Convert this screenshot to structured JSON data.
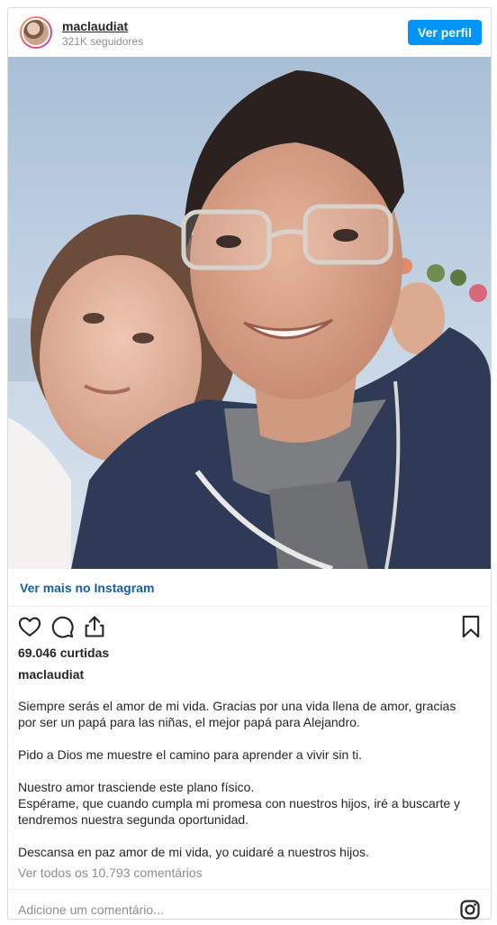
{
  "header": {
    "username": "maclaudiat",
    "followers": "321K seguidores",
    "profile_button": "Ver perfil"
  },
  "post": {
    "see_more": "Ver mais no Instagram",
    "likes": "69.046 curtidas",
    "caption_user": "maclaudiat",
    "caption_paragraphs": [
      "Siempre serás el amor de mi vida. Gracias por una vida llena de amor, gracias por ser un papá para las niñas, el mejor papá para Alejandro.",
      "Pido a Dios me muestre el camino para aprender a vivir sin ti.",
      "Nuestro amor trasciende este plano físico.",
      "Espérame, que cuando cumpla mi promesa con nuestros hijos, iré a buscarte y tendremos nuestra segunda oportunidad.",
      "Descansa en paz amor de mi vida, yo cuidaré a nuestros hijos."
    ],
    "view_comments": "Ver todos os 10.793 comentários",
    "add_comment_placeholder": "Adicione um comentário..."
  },
  "icons": {
    "like": "heart-icon",
    "comment": "comment-icon",
    "share": "share-icon",
    "save": "bookmark-icon",
    "instagram": "instagram-icon"
  },
  "colors": {
    "accent": "#0095f6",
    "link": "#1560a8",
    "muted": "#8e8e8e"
  }
}
